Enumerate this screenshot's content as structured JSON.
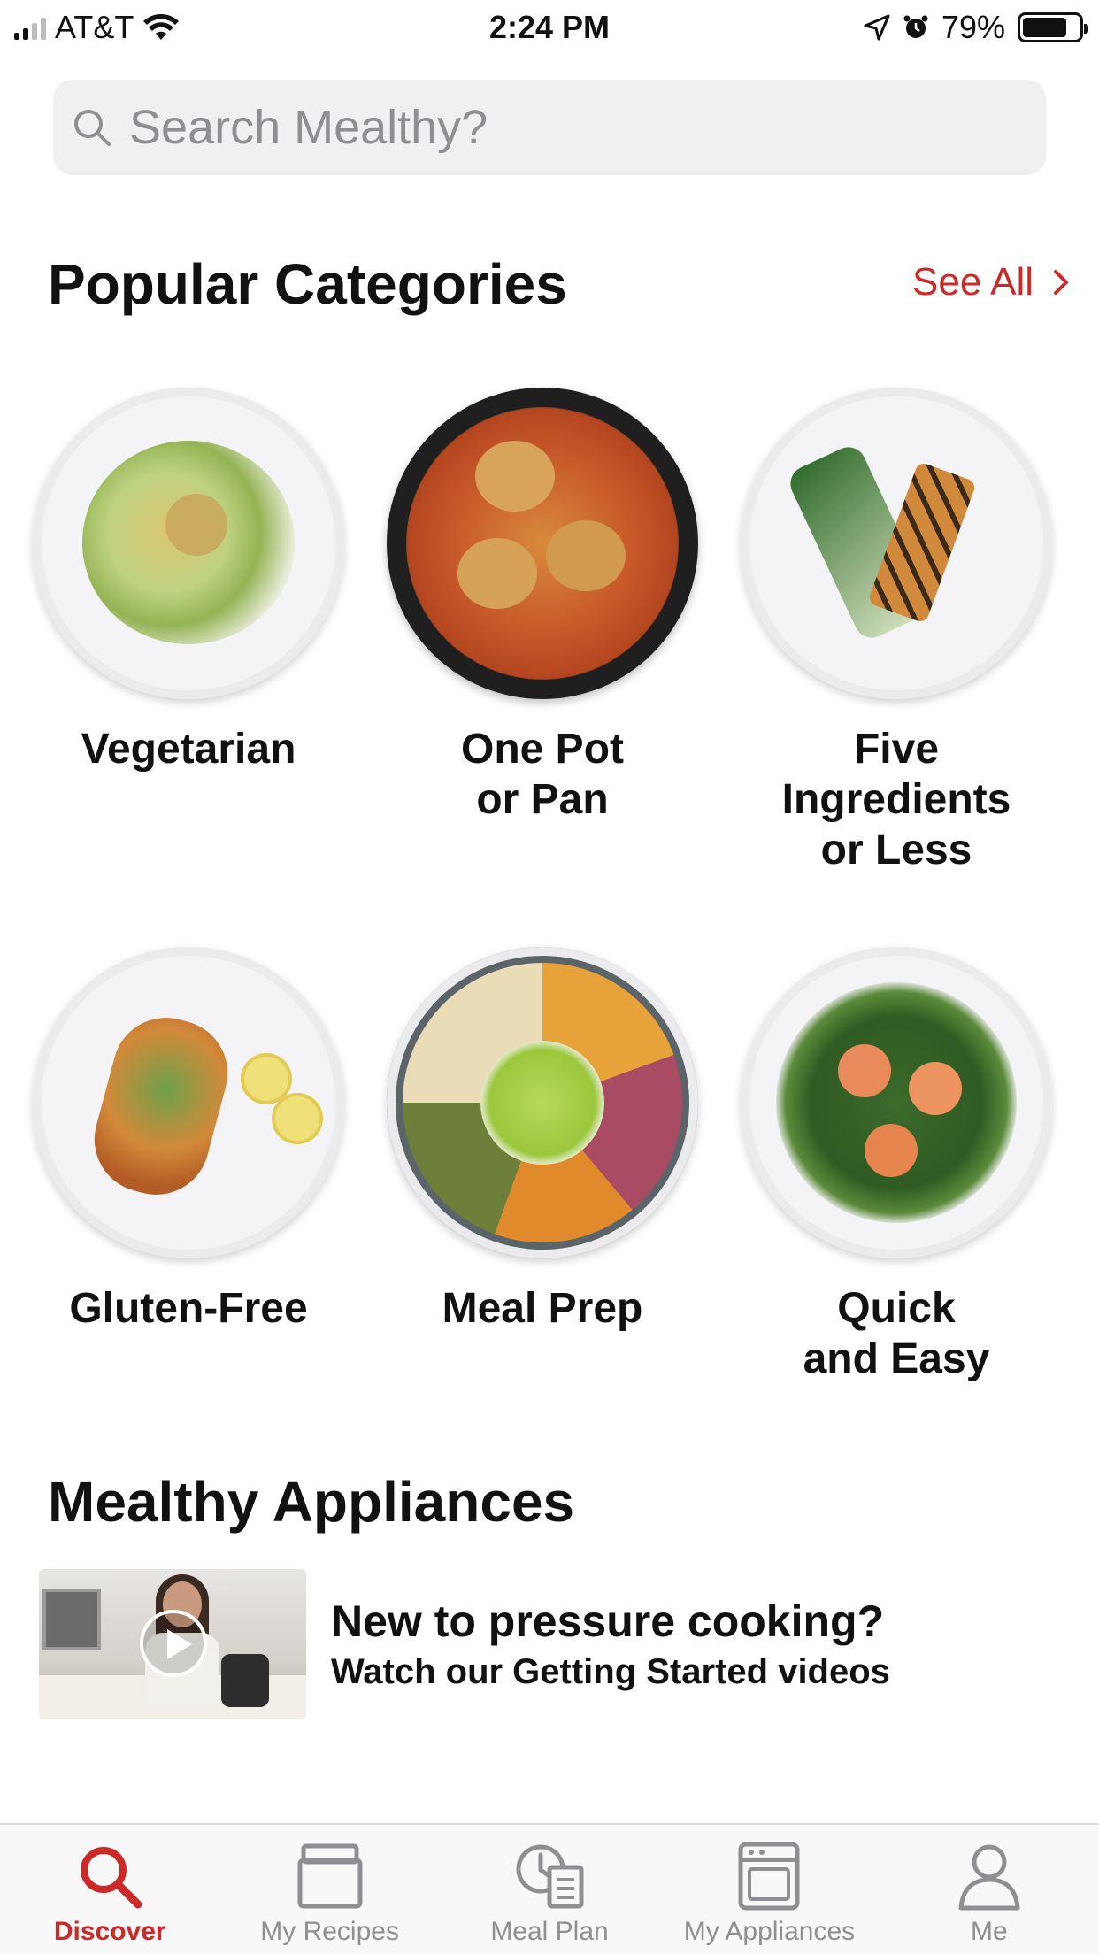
{
  "status_bar": {
    "carrier": "AT&T",
    "time": "2:24 PM",
    "battery": "79%",
    "battery_level": 0.79
  },
  "search": {
    "placeholder": "Search Mealthy?",
    "value": ""
  },
  "popular_categories": {
    "title": "Popular Categories",
    "see_all": "See All",
    "items": [
      {
        "label": "Vegetarian",
        "image_icon": "zucchini-noodle-plate"
      },
      {
        "label": "One Pot\nor Pan",
        "image_icon": "skillet-chicken"
      },
      {
        "label": "Five\nIngredients\nor Less",
        "image_icon": "grilled-tofu-scallions-plate"
      },
      {
        "label": "Gluten-Free",
        "image_icon": "stuffed-sweet-potato-plate"
      },
      {
        "label": "Meal Prep",
        "image_icon": "meal-prep-bowl"
      },
      {
        "label": "Quick\nand Easy",
        "image_icon": "citrus-salad-plate"
      }
    ]
  },
  "appliances": {
    "title": "Mealthy Appliances",
    "card": {
      "title": "New to pressure cooking?",
      "subtitle": "Watch our Getting Started videos",
      "thumbnail_icon": "video-play-icon"
    }
  },
  "tab_bar": {
    "items": [
      {
        "label": "Discover",
        "icon": "search-icon",
        "active": true
      },
      {
        "label": "My Recipes",
        "icon": "recipe-box-icon",
        "active": false
      },
      {
        "label": "Meal Plan",
        "icon": "clock-list-icon",
        "active": false
      },
      {
        "label": "My Appliances",
        "icon": "appliance-icon",
        "active": false
      },
      {
        "label": "Me",
        "icon": "person-icon",
        "active": false
      }
    ]
  },
  "colors": {
    "accent": "#cc2a28",
    "inactive_tab": "#8e8e93",
    "search_bg": "#f0f0f3"
  }
}
